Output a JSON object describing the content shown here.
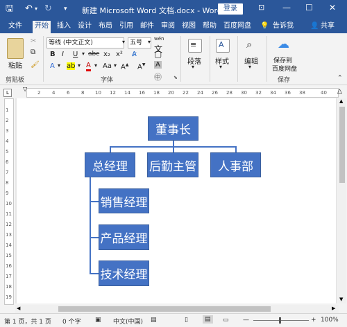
{
  "window": {
    "title": "新建 Microsoft Word 文档.docx  -  Word",
    "login_label": "登录",
    "icons": [
      "save-icon",
      "undo-icon",
      "redo-icon",
      "customize-icon",
      "ribbon-display-icon",
      "minimize-icon",
      "maximize-icon",
      "close-icon"
    ]
  },
  "tabs": {
    "file": "文件",
    "home": "开始",
    "insert": "插入",
    "design": "设计",
    "layout": "布局",
    "references": "引用",
    "mailings": "邮件",
    "review": "审阅",
    "view": "视图",
    "help": "帮助",
    "baidu": "百度网盘",
    "tellme": "告诉我",
    "share": "共享"
  },
  "ribbon": {
    "paste_label": "粘贴",
    "clipboard_group": "剪贴板",
    "font_name": "等线 (中文正文)",
    "font_size": "五号",
    "wen_label": "wén",
    "font_group": "字体",
    "bold": "B",
    "italic": "I",
    "underline": "U",
    "strike": "abc",
    "subscript": "x₂",
    "superscript": "x²",
    "aa_label": "Aa",
    "font_color": "A",
    "paragraph_label": "段落",
    "styles_label": "样式",
    "editing_label": "编辑",
    "save_to_baidu": "保存到",
    "save_to_baidu2": "百度网盘",
    "save_group": "保存"
  },
  "ruler": {
    "h_ticks": [
      "2",
      "4",
      "6",
      "8",
      "10",
      "12",
      "14",
      "16",
      "18",
      "20",
      "22",
      "24",
      "26",
      "28",
      "30",
      "32",
      "34",
      "36",
      "38",
      "40"
    ],
    "v_ticks": [
      "1",
      "2",
      "3",
      "4",
      "5",
      "6",
      "7",
      "8",
      "9",
      "10",
      "11",
      "12",
      "13",
      "14",
      "15",
      "16",
      "17",
      "18",
      "19"
    ]
  },
  "org_chart": {
    "root": "董事长",
    "level2": [
      "总经理",
      "后勤主管",
      "人事部"
    ],
    "children": [
      "销售经理",
      "产品经理",
      "技术经理"
    ],
    "color": "#4472c4"
  },
  "status": {
    "page": "第 1 页，共 1 页",
    "words": "0 个字",
    "language": "中文(中国)",
    "zoom": "100%",
    "minus": "—",
    "plus": "+"
  }
}
